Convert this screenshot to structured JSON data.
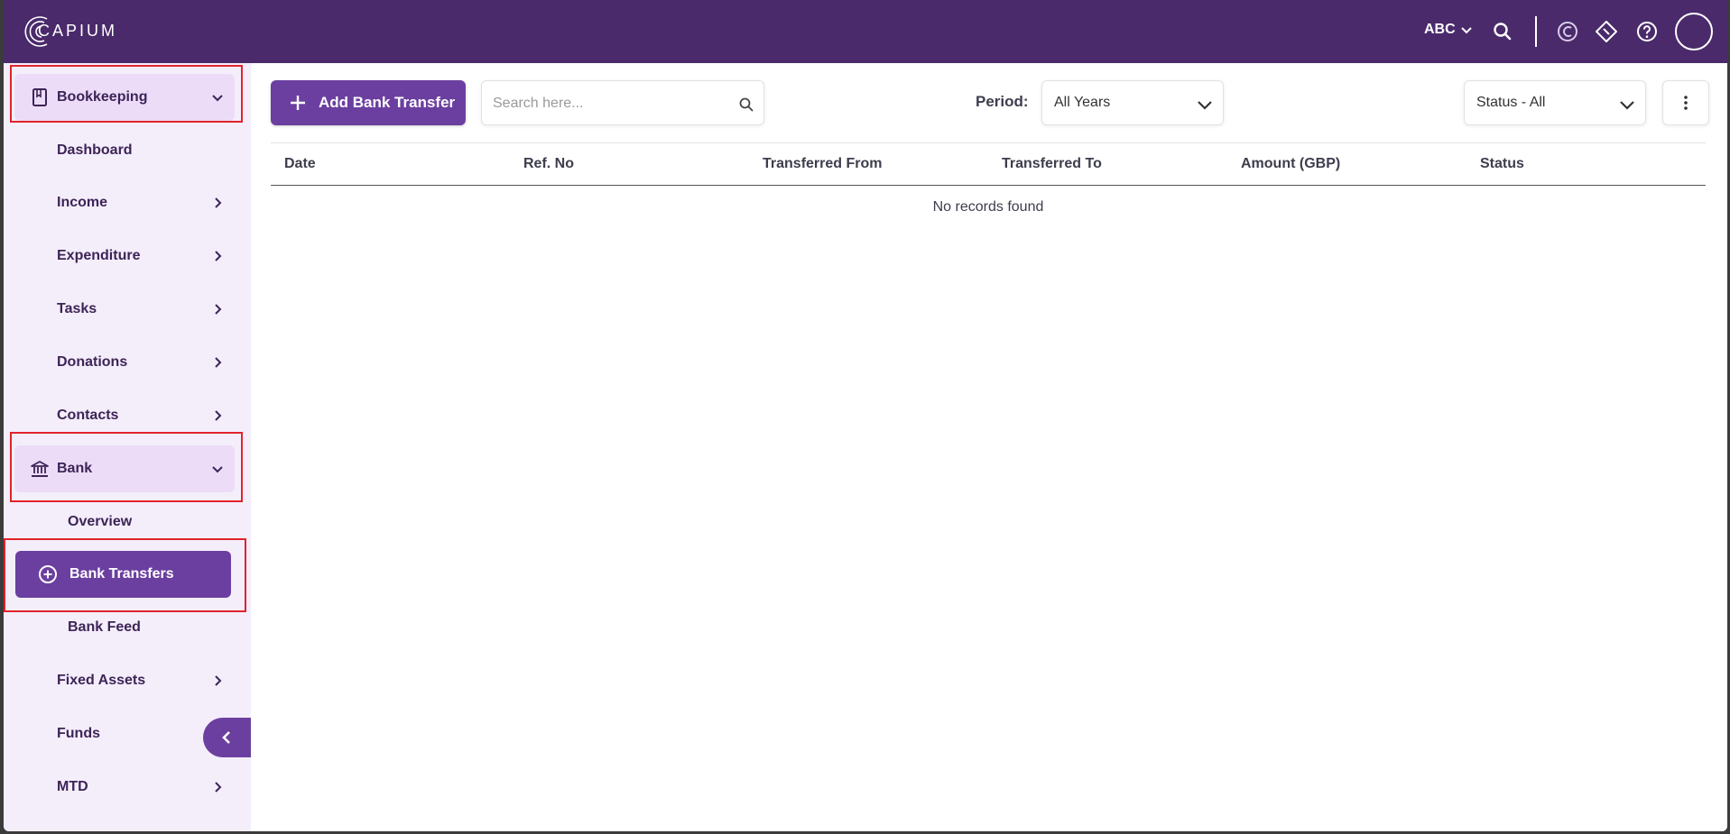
{
  "app": {
    "brand": "CAPIUM",
    "org_switch": "ABC"
  },
  "sidebar": {
    "bookkeeping": "Bookkeeping",
    "items": [
      {
        "label": "Dashboard"
      },
      {
        "label": "Income"
      },
      {
        "label": "Expenditure"
      },
      {
        "label": "Tasks"
      },
      {
        "label": "Donations"
      },
      {
        "label": "Contacts"
      }
    ],
    "bank": "Bank",
    "bank_items": [
      {
        "label": "Overview"
      },
      {
        "label": "Bank Transfers"
      },
      {
        "label": "Bank Feed"
      }
    ],
    "after_items": [
      {
        "label": "Fixed Assets"
      },
      {
        "label": "Funds"
      },
      {
        "label": "MTD"
      }
    ]
  },
  "toolbar": {
    "add_label": "Add Bank Transfer",
    "search_placeholder": "Search here...",
    "period_label": "Period:",
    "period_value": "All Years",
    "status_value": "Status - All"
  },
  "table": {
    "columns": [
      "Date",
      "Ref. No",
      "Transferred From",
      "Transferred To",
      "Amount (GBP)",
      "Status"
    ],
    "empty_text": "No records found"
  },
  "colors": {
    "topbar": "#4a2a6b",
    "accent": "#6b3fa0",
    "sidebar_bg": "#f4eefb",
    "highlight_box": "#e0242b"
  }
}
